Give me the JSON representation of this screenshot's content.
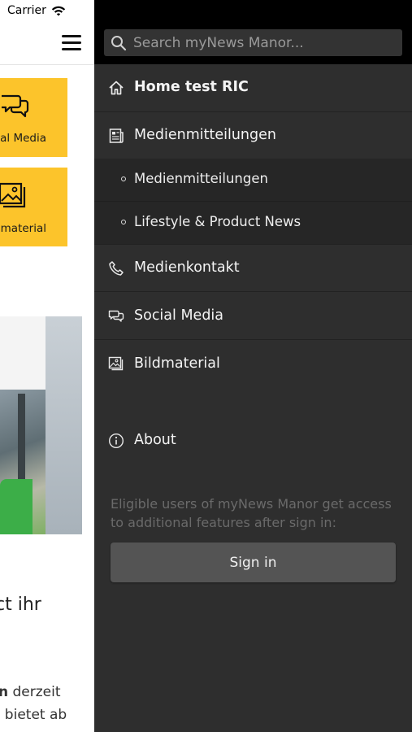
{
  "status_bar": {
    "carrier": "Carrier"
  },
  "background_page": {
    "tiles": [
      {
        "label": "al Media"
      },
      {
        "label": "material"
      }
    ],
    "headline_fragment": "ct ihr",
    "body_fragment_line1_bold": "n",
    "body_fragment_line1": " derzeit",
    "body_fragment_line2": ", bietet ab",
    "accent_color": "#fcc42b"
  },
  "drawer": {
    "search": {
      "placeholder": "Search myNews Manor..."
    },
    "items": [
      {
        "label": "Home test RIC",
        "icon": "home-icon"
      },
      {
        "label": "Medienmitteilungen",
        "icon": "newspaper-icon"
      },
      {
        "label": "Medienkontakt",
        "icon": "phone-icon"
      },
      {
        "label": "Social Media",
        "icon": "chat-bubbles-icon"
      },
      {
        "label": "Bildmaterial",
        "icon": "image-icon"
      }
    ],
    "subitems": [
      {
        "label": "Medienmitteilungen"
      },
      {
        "label": "Lifestyle & Product News"
      }
    ],
    "about": {
      "label": "About",
      "icon": "info-icon"
    },
    "signin_note": "Eligible users of myNews Manor get access to additional features after sign in:",
    "signin_button": "Sign in",
    "colors": {
      "background": "#2e2e2e",
      "search_bar": "#000000",
      "button": "#545454"
    }
  }
}
